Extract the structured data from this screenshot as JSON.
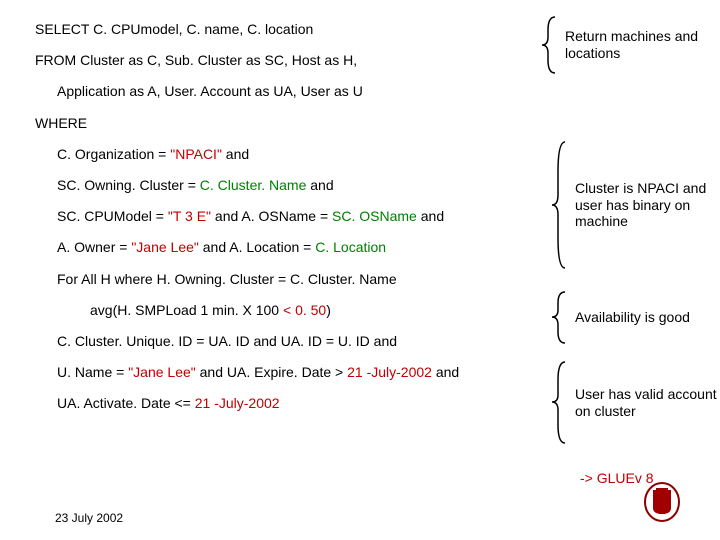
{
  "query": {
    "line1": "SELECT C. CPUmodel, C. name, C. location",
    "line2": "FROM Cluster as C, Sub. Cluster as SC, Host as H,",
    "line3": "Application as A, User. Account as UA,  User as U",
    "line4": "WHERE",
    "line5a": "C. Organization = ",
    "line5b": "\"NPACI\"",
    "line5c": " and ",
    "line6a": "SC. Owning. Cluster = ",
    "line6b": "C. Cluster. Name",
    "line6c": " and ",
    "line7a": "SC. CPUModel = ",
    "line7b": "\"T 3 E\"",
    "line7c": " and  A. OSName = ",
    "line7d": "SC. OSName",
    "line7e": " and",
    "line8a": "A. Owner = ",
    "line8b": "\"Jane Lee\"",
    "line8c": " and A. Location = ",
    "line8d": "C. Location",
    "line9": "For All H where H. Owning. Cluster = C. Cluster. Name",
    "line10a": "avg(H. SMPLoad 1 min. X 100 ",
    "line10b": "< 0. 50",
    "line10c": ")",
    "line11": "C. Cluster. Unique. ID = UA. ID and UA. ID = U. ID and",
    "line12a": "U. Name = ",
    "line12b": "\"Jane Lee\"",
    "line12c": " and UA. Expire. Date > ",
    "line12d": "21 -July-2002",
    "line12e": " and",
    "line13a": "UA. Activate. Date <= ",
    "line13b": "21 -July-2002"
  },
  "annotations": {
    "a1": "Return machines and locations",
    "a2": "Cluster is NPACI and user has binary on machine",
    "a3": "Availability is good",
    "a4": "User has valid account on cluster"
  },
  "gluev": "-> GLUEv 8",
  "footer_date": "23 July 2002"
}
